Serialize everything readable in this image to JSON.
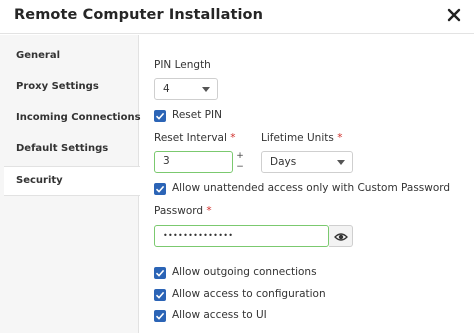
{
  "dialog": {
    "title": "Remote Computer Installation",
    "close_icon": "close-icon"
  },
  "sidebar": {
    "items": [
      {
        "label": "General"
      },
      {
        "label": "Proxy Settings"
      },
      {
        "label": "Incoming Connections"
      },
      {
        "label": "Default Settings"
      },
      {
        "label": "Security",
        "active": true
      }
    ]
  },
  "form": {
    "pin_length": {
      "label": "PIN Length",
      "value": "4"
    },
    "reset_pin": {
      "label": "Reset PIN",
      "checked": true
    },
    "reset_interval": {
      "label": "Reset Interval",
      "required_mark": "*",
      "value": "3"
    },
    "lifetime_units": {
      "label": "Lifetime Units",
      "required_mark": "*",
      "value": "Days"
    },
    "unattended": {
      "label": "Allow unattended access only with Custom Password",
      "checked": true
    },
    "password": {
      "label": "Password",
      "required_mark": "*",
      "value": "••••••••••••••"
    },
    "stepper": {
      "up": "+",
      "down": "−"
    },
    "allow_outgoing": {
      "label": "Allow outgoing connections",
      "checked": true
    },
    "allow_config": {
      "label": "Allow access to configuration",
      "checked": true
    },
    "allow_ui": {
      "label": "Allow access to UI",
      "checked": true
    }
  },
  "colors": {
    "accent": "#2b64b6",
    "valid_border": "#7bc96f",
    "required": "#d0312d"
  }
}
